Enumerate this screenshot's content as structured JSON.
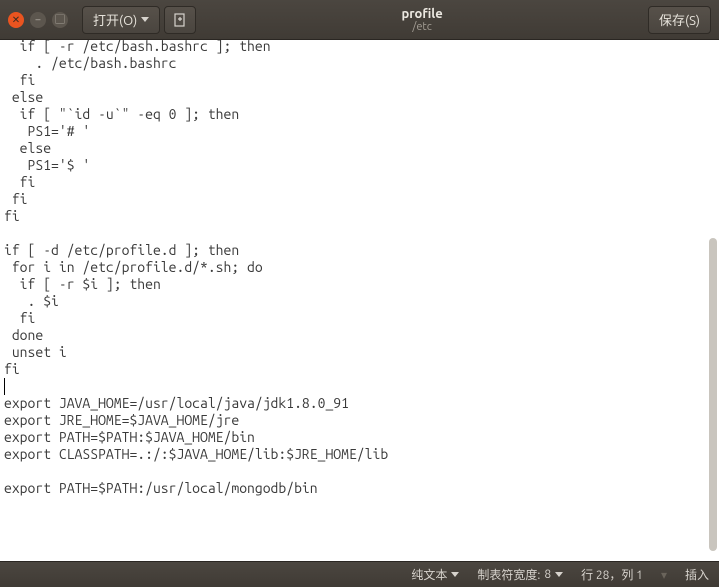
{
  "window": {
    "title": "profile",
    "subtitle": "/etc"
  },
  "toolbar": {
    "open_label": "打开(O)",
    "save_label": "保存(S)"
  },
  "editor": {
    "content": "  if [ -r /etc/bash.bashrc ]; then\n    . /etc/bash.bashrc\n  fi\n else\n  if [ \"`id -u`\" -eq 0 ]; then\n   PS1='# '\n  else\n   PS1='$ '\n  fi\n fi\nfi\n\nif [ -d /etc/profile.d ]; then\n for i in /etc/profile.d/*.sh; do\n  if [ -r $i ]; then\n   . $i\n  fi\n done\n unset i\nfi\n\nexport JAVA_HOME=/usr/local/java/jdk1.8.0_91\nexport JRE_HOME=$JAVA_HOME/jre\nexport PATH=$PATH:$JAVA_HOME/bin\nexport CLASSPATH=.:/:$JAVA_HOME/lib:$JRE_HOME/lib\n\nexport PATH=$PATH:/usr/local/mongodb/bin\n"
  },
  "statusbar": {
    "syntax": "纯文本",
    "tab_label": "制表符宽度:",
    "tab_width": "8",
    "line_col": "行 28，列 1",
    "mode": "插入"
  }
}
